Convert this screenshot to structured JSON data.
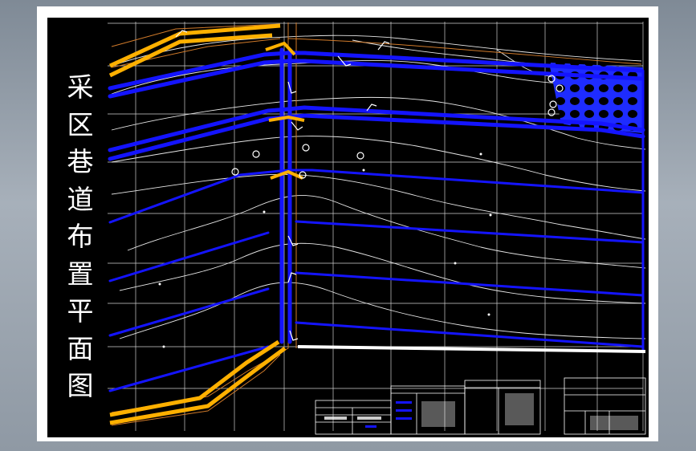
{
  "drawing": {
    "title_chars": [
      "采",
      "区",
      "巷",
      "道",
      "布",
      "置",
      "平",
      "面",
      "图"
    ]
  },
  "colors": {
    "background": "#000000",
    "paper": "#ffffff",
    "roadway_blue": "#1414ff",
    "main_roadway_orange": "#ffb000",
    "contour": "#e6e6e6",
    "boundary": "#d07a2a",
    "goaf_hatch": "#1e2cff"
  },
  "icons": [
    "compass-marker-icon",
    "hatch-pattern-icon"
  ]
}
